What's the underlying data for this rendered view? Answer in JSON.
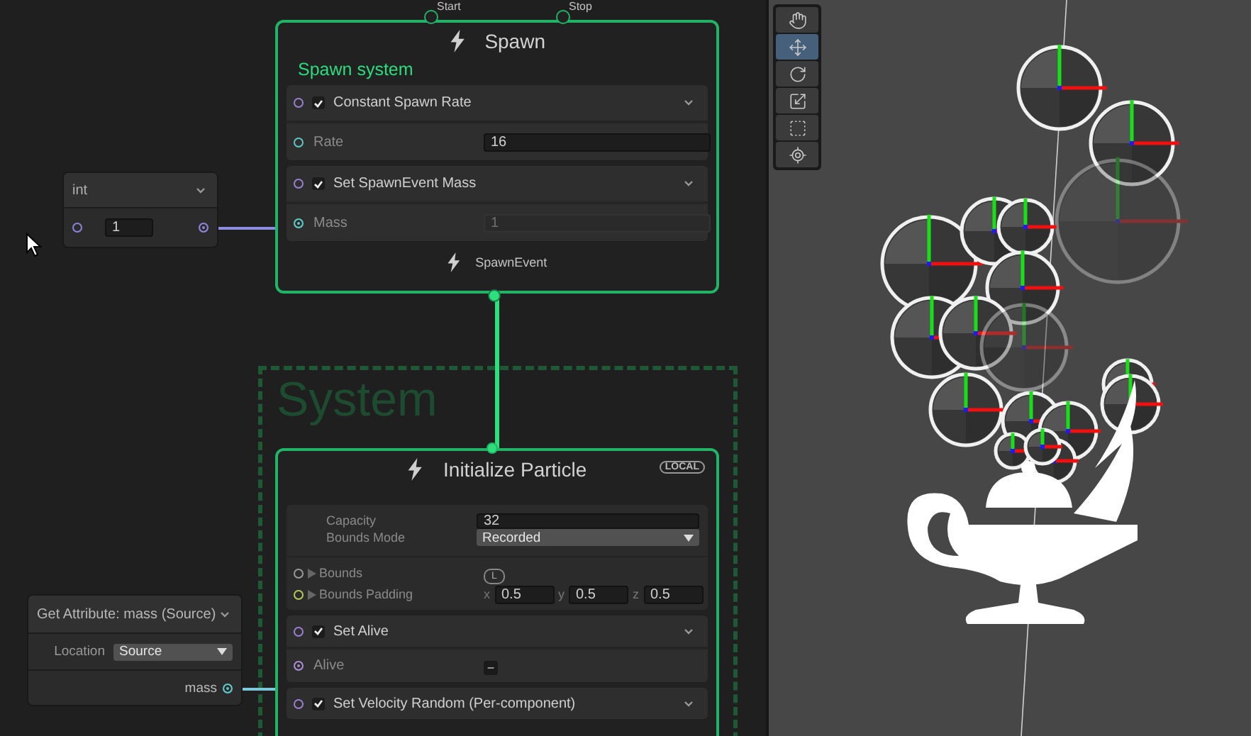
{
  "int_node": {
    "title": "int",
    "value": "1"
  },
  "spawn_context": {
    "ports": [
      "Start",
      "Stop"
    ],
    "title": "Spawn",
    "subtitle": "Spawn system",
    "footer": "SpawnEvent",
    "blocks": [
      {
        "title": "Constant Spawn Rate",
        "enabled": true,
        "fields": [
          {
            "label": "Rate",
            "value": "16",
            "connected": false
          }
        ]
      },
      {
        "title": "Set SpawnEvent Mass",
        "enabled": true,
        "fields": [
          {
            "label": "Mass",
            "value": "1",
            "connected": true
          }
        ]
      }
    ]
  },
  "system_group": {
    "title": "System"
  },
  "initialize_context": {
    "title": "Initialize Particle",
    "badge": "LOCAL",
    "settings": [
      {
        "label": "Capacity",
        "value": "32",
        "kind": "text"
      },
      {
        "label": "Bounds Mode",
        "value": "Recorded",
        "kind": "dropdown"
      }
    ],
    "bounds": {
      "label": "Bounds",
      "space": "L"
    },
    "padding": {
      "label": "Bounds Padding",
      "components": [
        {
          "axis": "x",
          "value": "0.5"
        },
        {
          "axis": "y",
          "value": "0.5"
        },
        {
          "axis": "z",
          "value": "0.5"
        }
      ]
    },
    "blocks": [
      {
        "title": "Set Alive",
        "enabled": true,
        "fields": [
          {
            "label": "Alive",
            "value": "−",
            "connected": true
          }
        ]
      },
      {
        "title": "Set Velocity Random (Per-component)",
        "enabled": true
      }
    ]
  },
  "get_attribute": {
    "title": "Get Attribute: mass (Source)",
    "location_label": "Location",
    "location": "Source",
    "output": "mass"
  },
  "scene_tools": [
    {
      "kind": "hand",
      "selected": false
    },
    {
      "kind": "move",
      "selected": true
    },
    {
      "kind": "rotate",
      "selected": false
    },
    {
      "kind": "scale",
      "selected": false
    },
    {
      "kind": "rect",
      "selected": false
    },
    {
      "kind": "transform",
      "selected": false
    }
  ]
}
